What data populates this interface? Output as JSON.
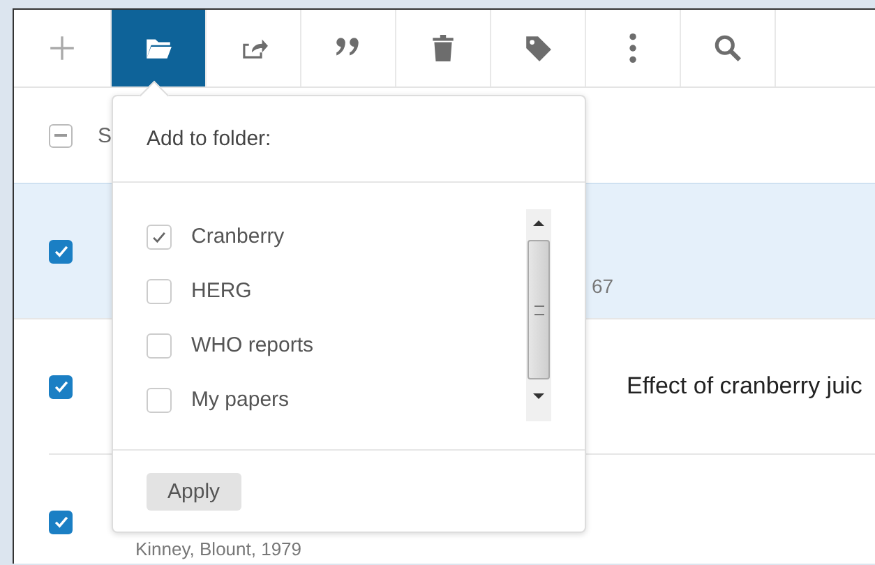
{
  "toolbar": [
    {
      "kind": "add",
      "selected": false
    },
    {
      "kind": "folder",
      "selected": true
    },
    {
      "kind": "share",
      "selected": false
    },
    {
      "kind": "quote",
      "selected": false
    },
    {
      "kind": "trash",
      "selected": false
    },
    {
      "kind": "tag",
      "selected": false
    },
    {
      "kind": "more",
      "selected": false
    },
    {
      "kind": "search",
      "selected": false
    }
  ],
  "list_header": {
    "label": "S",
    "indeterminate": true
  },
  "rows": [
    {
      "checked": true,
      "selected": true,
      "title": "",
      "meta": "67"
    },
    {
      "checked": true,
      "selected": false,
      "title": "Effect of cranberry juic",
      "meta": ""
    },
    {
      "checked": true,
      "selected": false,
      "title": "",
      "meta": "Kinney, Blount, 1979"
    }
  ],
  "popover": {
    "title": "Add to folder:",
    "folders": [
      {
        "label": "Cranberry",
        "checked": true
      },
      {
        "label": "HERG",
        "checked": false
      },
      {
        "label": "WHO reports",
        "checked": false
      },
      {
        "label": "My papers",
        "checked": false
      }
    ],
    "button": "Apply"
  }
}
